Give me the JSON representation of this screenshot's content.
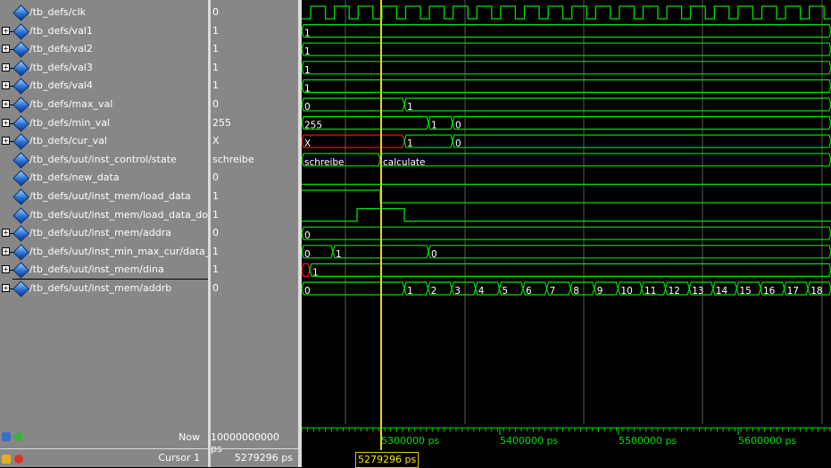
{
  "signals": [
    {
      "name": "/tb_defs/clk",
      "value": "0",
      "expandable": false
    },
    {
      "name": "/tb_defs/val1",
      "value": "1",
      "expandable": true
    },
    {
      "name": "/tb_defs/val2",
      "value": "1",
      "expandable": true
    },
    {
      "name": "/tb_defs/val3",
      "value": "1",
      "expandable": true
    },
    {
      "name": "/tb_defs/val4",
      "value": "1",
      "expandable": true
    },
    {
      "name": "/tb_defs/max_val",
      "value": "0",
      "expandable": true
    },
    {
      "name": "/tb_defs/min_val",
      "value": "255",
      "expandable": true
    },
    {
      "name": "/tb_defs/cur_val",
      "value": "X",
      "expandable": true
    },
    {
      "name": "/tb_defs/uut/inst_control/state",
      "value": "schreibe",
      "expandable": false
    },
    {
      "name": "/tb_defs/new_data",
      "value": "0",
      "expandable": false
    },
    {
      "name": "/tb_defs/uut/inst_mem/load_data",
      "value": "1",
      "expandable": false
    },
    {
      "name": "/tb_defs/uut/inst_mem/load_data_done",
      "value": "1",
      "expandable": false
    },
    {
      "name": "/tb_defs/uut/inst_mem/addra",
      "value": "0",
      "expandable": true
    },
    {
      "name": "/tb_defs/uut/inst_min_max_cur/data_in",
      "value": "1",
      "expandable": true
    },
    {
      "name": "/tb_defs/uut/inst_mem/dina",
      "value": "1",
      "expandable": true
    },
    {
      "name": "/tb_defs/uut/inst_mem/addrb",
      "value": "0",
      "expandable": true
    }
  ],
  "waves": {
    "val1": [
      "1"
    ],
    "val2": [
      "1"
    ],
    "val3": [
      "1"
    ],
    "val4": [
      "1"
    ],
    "max_val": [
      "0",
      "1"
    ],
    "min_val": [
      "255",
      "1",
      "0"
    ],
    "cur_val": [
      "X",
      "1",
      "0"
    ],
    "state": [
      "schreibe",
      "calculate"
    ],
    "addra": [
      "0"
    ],
    "data_in": [
      "0",
      "1",
      "0"
    ],
    "dina": [
      "1"
    ],
    "addrb": [
      "0",
      "1",
      "2",
      "3",
      "4",
      "5",
      "6",
      "7",
      "8",
      "9",
      "10",
      "11",
      "12",
      "13",
      "14",
      "15",
      "16",
      "17",
      "18"
    ]
  },
  "footer": {
    "now_label": "Now",
    "now_value": "10000000000 ps",
    "cursor_label": "Cursor 1",
    "cursor_value": "5279296 ps",
    "cursor_box": "5279296 ps",
    "tick_labels": [
      "5300000 ps",
      "5400000 ps",
      "5500000 ps",
      "5600000 ps"
    ]
  },
  "colors": {
    "wave": "#00e000",
    "cursor": "#f0d020",
    "undefined": "#e02020",
    "grid": "#5a5a5a"
  }
}
